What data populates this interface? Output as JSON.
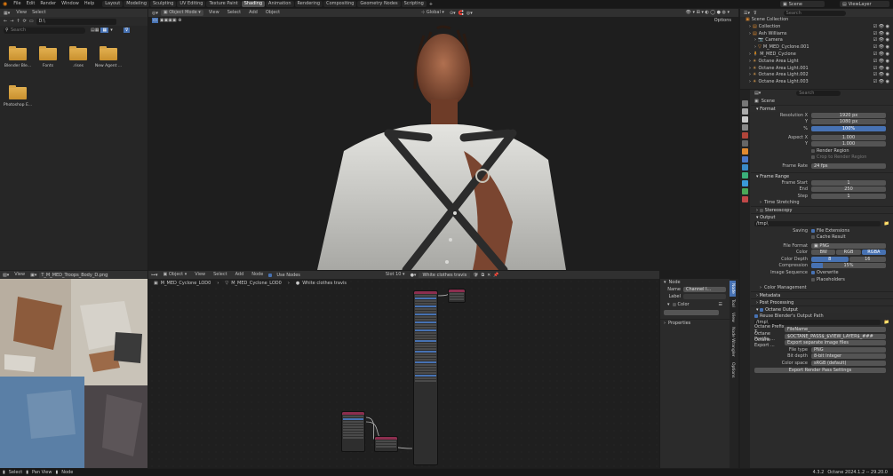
{
  "topbar": {
    "menus": [
      "File",
      "Edit",
      "Render",
      "Window",
      "Help"
    ],
    "workspaces": [
      "Layout",
      "Modeling",
      "Sculpting",
      "UV Editing",
      "Texture Paint",
      "Shading",
      "Animation",
      "Rendering",
      "Compositing",
      "Geometry Nodes",
      "Scripting"
    ],
    "active_workspace": "Shading",
    "scene": "Scene",
    "view_layer": "ViewLayer"
  },
  "filebrowser": {
    "menus": [
      "View",
      "Select"
    ],
    "path": "D:\\",
    "search_placeholder": "Search",
    "folders": [
      "Blender Ble...",
      "Fonts",
      ".rises",
      "New Agent ...",
      "Photoshop E..."
    ]
  },
  "viewport": {
    "mode": "Object Mode",
    "menus": [
      "View",
      "Select",
      "Add",
      "Object"
    ],
    "orientation": "Global",
    "options_label": "Options"
  },
  "outliner": {
    "search_placeholder": "Search",
    "items": [
      {
        "label": "Scene Collection",
        "indent": 0,
        "selected": false
      },
      {
        "label": "Collection",
        "indent": 1,
        "selected": false
      },
      {
        "label": "Ash Williams",
        "indent": 1,
        "selected": false
      },
      {
        "label": "Camera",
        "indent": 2,
        "selected": false
      },
      {
        "label": "M_MED_Cyclone.001",
        "indent": 2,
        "selected": false
      },
      {
        "label": "M_MED_Cyclone",
        "indent": 1,
        "selected": false
      },
      {
        "label": "Octane Area Light",
        "indent": 1,
        "selected": false
      },
      {
        "label": "Octane Area Light.001",
        "indent": 1,
        "selected": false
      },
      {
        "label": "Octane Area Light.002",
        "indent": 1,
        "selected": false
      },
      {
        "label": "Octane Area Light.003",
        "indent": 1,
        "selected": false
      }
    ]
  },
  "properties": {
    "search_placeholder": "Search",
    "scene_label": "Scene",
    "format": {
      "title": "Format",
      "resolution_x_label": "Resolution X",
      "resolution_x": "1920 px",
      "resolution_y_label": "Y",
      "resolution_y": "1080 px",
      "percent_label": "%",
      "percent": "100%",
      "aspect_x_label": "Aspect X",
      "aspect_x": "1.000",
      "aspect_y_label": "Y",
      "aspect_y": "1.000",
      "render_region": "Render Region",
      "crop_region": "Crop to Render Region",
      "frame_rate_label": "Frame Rate",
      "frame_rate": "24 fps"
    },
    "frame_range": {
      "title": "Frame Range",
      "start_label": "Frame Start",
      "start": "1",
      "end_label": "End",
      "end": "250",
      "step_label": "Step",
      "step": "1",
      "time_stretching": "Time Stretching"
    },
    "stereoscopy": "Stereoscopy",
    "output": {
      "title": "Output",
      "path": "/tmp\\",
      "saving_label": "Saving",
      "file_extensions": "File Extensions",
      "cache_result": "Cache Result",
      "file_format_label": "File Format",
      "file_format": "PNG",
      "color_label": "Color",
      "color_options": [
        "BW",
        "RGB",
        "RGBA"
      ],
      "color_active": "RGBA",
      "depth_label": "Color Depth",
      "depth_options": [
        "8",
        "16"
      ],
      "depth_active": "8",
      "compression_label": "Compression",
      "compression": "15%",
      "compression_fraction": 0.15,
      "image_sequence_label": "Image Sequence",
      "overwrite": "Overwrite",
      "placeholders": "Placeholders",
      "color_management": "Color Management"
    },
    "metadata": "Metadata",
    "post_processing": "Post Processing",
    "octane_output": {
      "title": "Octane Output",
      "reuse_path": "Reuse Blender's Output Path",
      "path": "/tmp\\",
      "prefix_label": "Octane Prefix T...",
      "prefix": "FileName_",
      "postfix_label": "Octane Postfix ...",
      "postfix": "$OCTANE_PASS$_$VIEW_LAYER$_###",
      "export_label": "Octane Export ...",
      "export": "Export separate image files",
      "file_type_label": "File type",
      "file_type": "PNG",
      "bit_depth_label": "Bit depth",
      "bit_depth": "8-bit Integer",
      "color_space_label": "Color space",
      "color_space": "sRGB (default)",
      "export_button": "Export Render Pass Settings"
    }
  },
  "uv_editor": {
    "menus": [
      "View"
    ],
    "image_name": "T_M_MED_Troops_Body_D.png"
  },
  "node_editor": {
    "type": "Object",
    "menus": [
      "View",
      "Select",
      "Add",
      "Node"
    ],
    "use_nodes": "Use Nodes",
    "slot": "Slot 10",
    "material": "White clothes travis",
    "breadcrumb": [
      "M_MED_Cyclone_LOD0",
      "M_MED_Cyclone_LOD0",
      "White clothes travis"
    ],
    "sidebar": {
      "section": "Node",
      "name_label": "Name",
      "name_value": "Channel I...",
      "label_label": "Label",
      "color_label": "Color",
      "properties_label": "Properties",
      "tabs": [
        "Node",
        "Tool",
        "View",
        "Node Wrangler",
        "Options"
      ]
    }
  },
  "statusbar": {
    "items": [
      "Select",
      "Pan View",
      "Node"
    ],
    "version": "4.3.2",
    "engine": "Octane 2024.1.2 -- 29.20.0"
  },
  "colors": {
    "accent": "#4772b3",
    "header": "#303030",
    "folder": "#e2b050"
  }
}
